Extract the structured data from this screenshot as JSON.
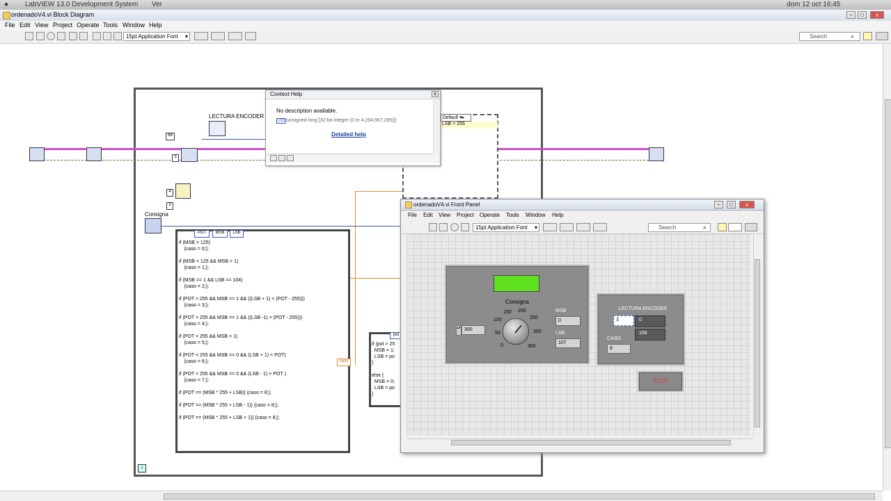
{
  "os_bar": {
    "app": "LabVIEW 13.0 Development System",
    "ver": "Ver",
    "clock": "dom 12 oct  16:45"
  },
  "window": {
    "title": "ordenadoV4.vi Block Diagram"
  },
  "menu": [
    "File",
    "Edit",
    "View",
    "Project",
    "Operate",
    "Tools",
    "Window",
    "Help"
  ],
  "toolbar": {
    "font_select": "15pt Application Font",
    "search_placeholder": "Search"
  },
  "diagram": {
    "lectura_label": "LECTURA ENCODER",
    "consigna_label": "Consigna",
    "const_88": "88",
    "const_5": "5",
    "const_4": "4",
    "const_3": "3",
    "node_pot": "POT",
    "node_msb": "MSB",
    "node_lsb": "LSB",
    "case_label": "caso",
    "case_selector": "Default",
    "case_cond": "LSB > 255",
    "small_code_header": "pot",
    "small_code": "if (pot > 25\n  MSB = 1;\n  LSB = po\n}\n\nelse {\n  MSB = 0;\n  LSB = po\n}",
    "formula_code": "if (MSB > 125)\n    {caso = 0;};\n\nif (MSB < 125 && MSB > 1)\n    {caso = 1;};\n\nif (MSB == 1 && LSB == 104)\n    {caso = 2;};\n\nif (POT > 255 && MSB == 1 && ((LSB + 1) < (POT - 255)))\n    {caso = 3;};\n\nif (POT > 255 && MSB == 1 && ((LSB -1) > (POT - 255)))\n    {caso = 4;};\n\nif (POT > 255 && MSB < 1)\n    {caso = 5;};\n\nif (POT < 255 && MSB == 0 && (LSB + 1) < POT)\n    {caso = 6;};\n\nif (POT < 255 && MSB == 0 && (LSB - 1) > POT )\n    {caso = 7;};\n\nif (POT == (MSB * 255 + LSB)) {caso = 8;};\n\nif (POT == (MSB * 255 + LSB - 1)) {caso = 8;};\n\nif (POT == (MSB * 255 + LSB + 1)) {caso = 8;};",
    "iteration_terminal": "i"
  },
  "context_help": {
    "title": "Context Help",
    "description": "No description available.",
    "type_info": "(unsigned long [32-bit integer (0 to 4,294,967,295)])",
    "type_badge": "U32",
    "link": "Detailed help"
  },
  "front_panel": {
    "title": "ordenadoV4.vi Front Panel",
    "menu": [
      "File",
      "Edit",
      "View",
      "Project",
      "Operate",
      "Tools",
      "Window",
      "Help"
    ],
    "font_select": "15pt Application Font",
    "search_placeholder": "Search",
    "consigna_label": "Consigna",
    "consigna_value": "300",
    "dial_ticks": [
      "0",
      "50",
      "100",
      "150",
      "200",
      "250",
      "300",
      "360"
    ],
    "msb_label": "MSB",
    "msb_value": "0",
    "lsb_label": "LSB",
    "lsb_value": "107",
    "lectura_label": "LECTURA ENCODER",
    "lectura_index": "3",
    "lectura_values": [
      "0",
      "108"
    ],
    "caso_label": "CASO",
    "caso_value": "8",
    "stop_label": "STOP",
    "led_color": "#5fe11f"
  }
}
